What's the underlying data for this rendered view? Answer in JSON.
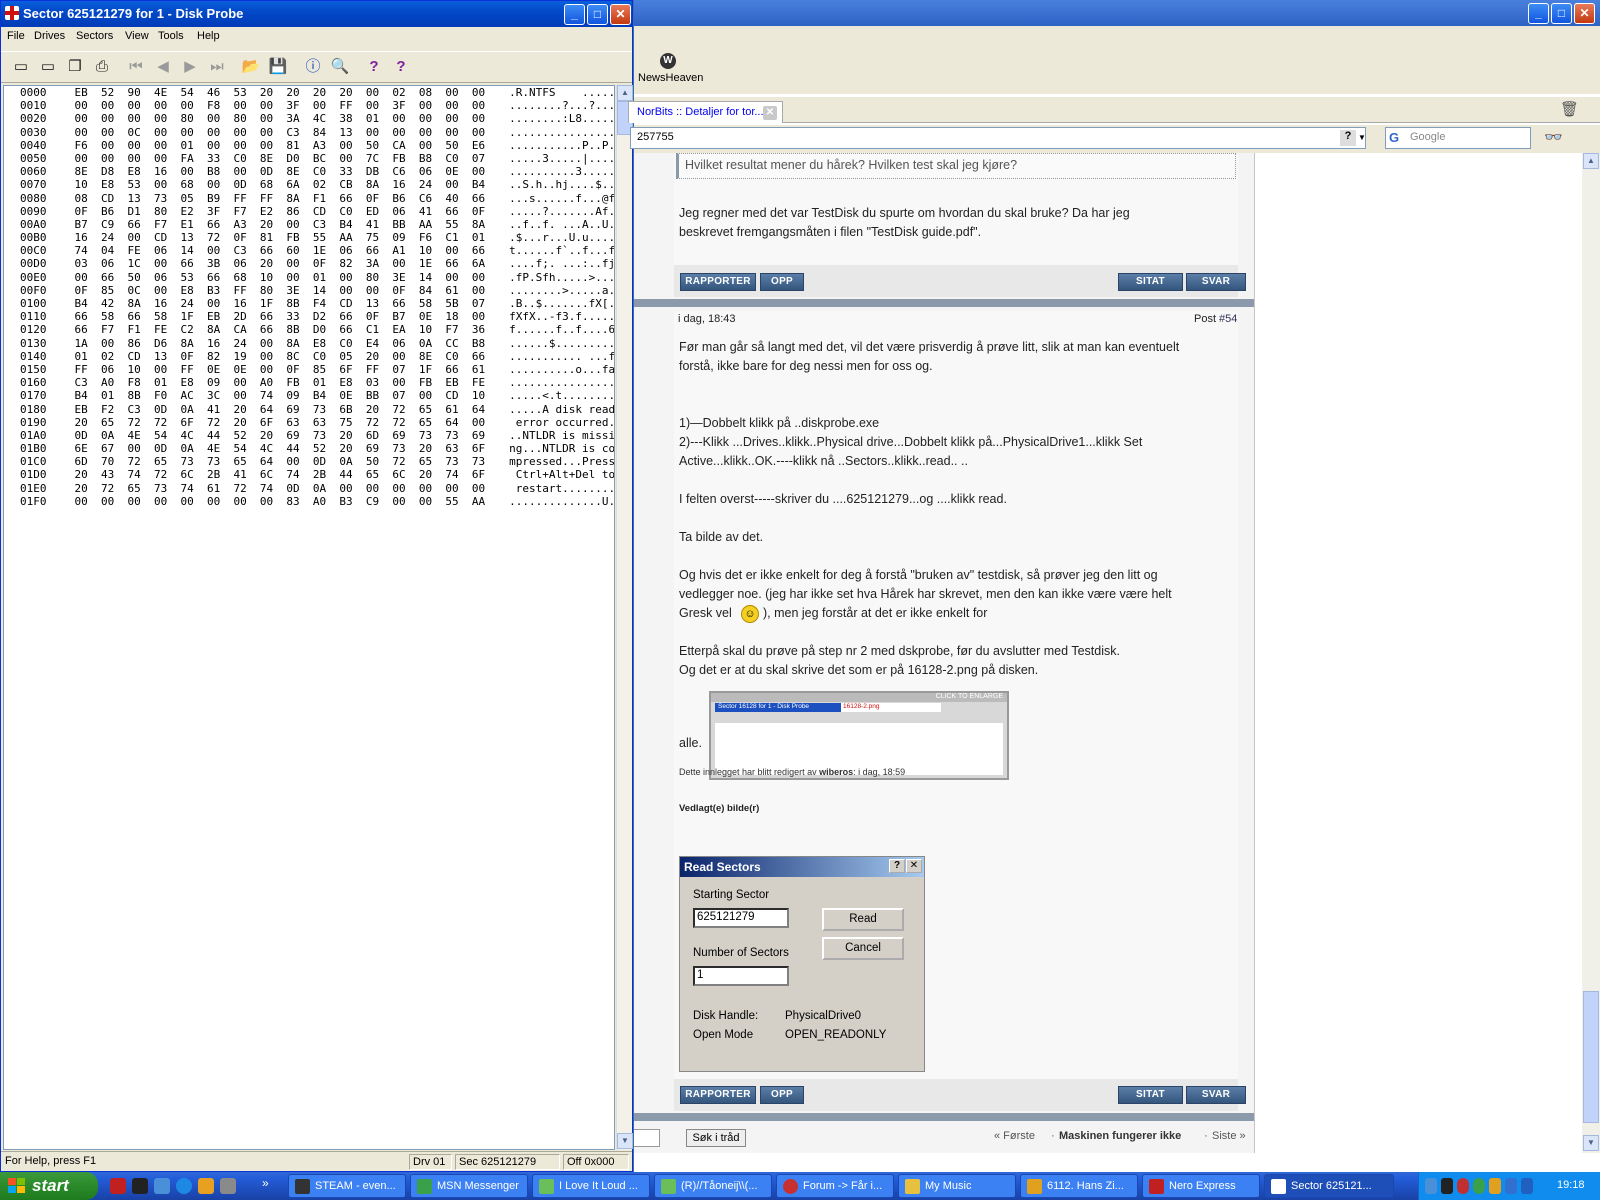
{
  "diskprobe": {
    "title": "Sector 625121279 for 1 - Disk Probe",
    "menu": [
      "File",
      "Drives",
      "Sectors",
      "View",
      "Tools",
      "Help"
    ],
    "hex_rows": [
      [
        "0000",
        "EB 52 90 4E 54 46 53 20 20 20 20 00 02 08 00 00",
        ".R.NTFS    ....."
      ],
      [
        "0010",
        "00 00 00 00 00 F8 00 00 3F 00 FF 00 3F 00 00 00",
        "........?...?..."
      ],
      [
        "0020",
        "00 00 00 00 80 00 80 00 3A 4C 38 01 00 00 00 00",
        "........:L8....."
      ],
      [
        "0030",
        "00 00 0C 00 00 00 00 00 C3 84 13 00 00 00 00 00",
        "................"
      ],
      [
        "0040",
        "F6 00 00 00 01 00 00 00 81 A3 00 50 CA 00 50 E6",
        "...........P..P."
      ],
      [
        "0050",
        "00 00 00 00 FA 33 C0 8E D0 BC 00 7C FB B8 C0 07",
        ".....3.....|...."
      ],
      [
        "0060",
        "8E D8 E8 16 00 B8 00 0D 8E C0 33 DB C6 06 0E 00",
        "..........3....."
      ],
      [
        "0070",
        "10 E8 53 00 68 00 0D 68 6A 02 CB 8A 16 24 00 B4",
        "..S.h..hj....$.."
      ],
      [
        "0080",
        "08 CD 13 73 05 B9 FF FF 8A F1 66 0F B6 C6 40 66",
        "...s......f...@f"
      ],
      [
        "0090",
        "0F B6 D1 80 E2 3F F7 E2 86 CD C0 ED 06 41 66 0F",
        ".....?.......Af."
      ],
      [
        "00A0",
        "B7 C9 66 F7 E1 66 A3 20 00 C3 B4 41 BB AA 55 8A",
        "..f..f. ...A..U."
      ],
      [
        "00B0",
        "16 24 00 CD 13 72 0F 81 FB 55 AA 75 09 F6 C1 01",
        ".$...r...U.u...."
      ],
      [
        "00C0",
        "74 04 FE 06 14 00 C3 66 60 1E 06 66 A1 10 00 66",
        "t......f`..f...f"
      ],
      [
        "00D0",
        "03 06 1C 00 66 3B 06 20 00 0F 82 3A 00 1E 66 6A",
        "....f;. ...:..fj"
      ],
      [
        "00E0",
        "00 66 50 06 53 66 68 10 00 01 00 80 3E 14 00 00",
        ".fP.Sfh.....>..."
      ],
      [
        "00F0",
        "0F 85 0C 00 E8 B3 FF 80 3E 14 00 00 0F 84 61 00",
        "........>.....a."
      ],
      [
        "0100",
        "B4 42 8A 16 24 00 16 1F 8B F4 CD 13 66 58 5B 07",
        ".B..$.......fX[."
      ],
      [
        "0110",
        "66 58 66 58 1F EB 2D 66 33 D2 66 0F B7 0E 18 00",
        "fXfX..-f3.f....."
      ],
      [
        "0120",
        "66 F7 F1 FE C2 8A CA 66 8B D0 66 C1 EA 10 F7 36",
        "f......f..f....6"
      ],
      [
        "0130",
        "1A 00 86 D6 8A 16 24 00 8A E8 C0 E4 06 0A CC B8",
        "......$........."
      ],
      [
        "0140",
        "01 02 CD 13 0F 82 19 00 8C C0 05 20 00 8E C0 66",
        "........... ...f"
      ],
      [
        "0150",
        "FF 06 10 00 FF 0E 0E 00 0F 85 6F FF 07 1F 66 61",
        "..........o...fa"
      ],
      [
        "0160",
        "C3 A0 F8 01 E8 09 00 A0 FB 01 E8 03 00 FB EB FE",
        "................"
      ],
      [
        "0170",
        "B4 01 8B F0 AC 3C 00 74 09 B4 0E BB 07 00 CD 10",
        ".....<.t........"
      ],
      [
        "0180",
        "EB F2 C3 0D 0A 41 20 64 69 73 6B 20 72 65 61 64",
        ".....A disk read"
      ],
      [
        "0190",
        "20 65 72 72 6F 72 20 6F 63 63 75 72 72 65 64 00",
        " error occurred."
      ],
      [
        "01A0",
        "0D 0A 4E 54 4C 44 52 20 69 73 20 6D 69 73 73 69",
        "..NTLDR is missi"
      ],
      [
        "01B0",
        "6E 67 00 0D 0A 4E 54 4C 44 52 20 69 73 20 63 6F",
        "ng...NTLDR is co"
      ],
      [
        "01C0",
        "6D 70 72 65 73 73 65 64 00 0D 0A 50 72 65 73 73",
        "mpressed...Press"
      ],
      [
        "01D0",
        "20 43 74 72 6C 2B 41 6C 74 2B 44 65 6C 20 74 6F",
        " Ctrl+Alt+Del to"
      ],
      [
        "01E0",
        "20 72 65 73 74 61 72 74 0D 0A 00 00 00 00 00 00",
        " restart........"
      ],
      [
        "01F0",
        "00 00 00 00 00 00 00 00 83 A0 B3 C9 00 00 55 AA",
        "..............U."
      ]
    ],
    "status": {
      "help": "For Help, press F1",
      "drv": "Drv  01",
      "sec": "Sec 625121279",
      "off": "Off 0x000"
    }
  },
  "browser": {
    "bookmark": "NewsHeaven",
    "tab_title": "NorBits :: Detaljer for tor...",
    "url_fragment": "257755",
    "search_placeholder": "Google",
    "quote": "Hvilket resultat mener du hårek? Hvilken test skal jeg kjøre?",
    "reply_line1": "Jeg regner med det var TestDisk du spurte om hvordan du skal bruke? Da har jeg",
    "reply_line2": "beskrevet fremgangsmåten i filen \"TestDisk guide.pdf\".",
    "btn_report": "RAPPORTER",
    "btn_up": "OPP",
    "btn_quote": "SITAT",
    "btn_reply": "SVAR",
    "post_date": "i dag, 18:43",
    "post_label": "Post",
    "post_number": "#54",
    "lines": [
      "Før man går så langt med det, vil det være prisverdig å prøve litt, slik at man kan eventuelt",
      "forstå, ikke bare for deg nessi men for oss og.",
      "1)—Dobbelt klikk på ..diskprobe.exe",
      "2)---Klikk ...Drives..klikk..Physical drive...Dobbelt klikk på...PhysicalDrive1...klikk Set",
      "Active...klikk..OK.----klikk nå ..Sectors..klikk..read.. ..",
      "I felten overst-----skriver du ....625121279...og ....klikk read.",
      "Ta bilde av det.",
      "Og hvis det er ikke enkelt for deg å forstå \"bruken av\" testdisk, så prøver jeg den litt og",
      "vedlegger noe. (jeg har ikke set hva Hårek har skrevet, men den kan ikke være være helt",
      "Gresk vel",
      "), men jeg forstår at det er ikke enkelt for",
      "Etterpå skal du prøve på step nr 2 med dskprobe, før du avslutter med Testdisk.",
      "Og det er at du skal skrive det som er på 16128-2.png på disken.",
      "alle."
    ],
    "thumb_caption": "CLICK TO ENLARGE",
    "thumb_title": "Sector 16128 for 1 - Disk Probe",
    "thumb_file": "16128-2.png",
    "edited_prefix": "Dette innlegget har blitt redigert av",
    "edited_user": "wiberos",
    "edited_when": ": i dag, 18:59",
    "attached": "Vedlagt(e) bilde(r)",
    "dialog": {
      "title": "Read Sectors",
      "starting_label": "Starting Sector",
      "starting_value": "625121279",
      "number_label": "Number of Sectors",
      "number_value": "1",
      "read": "Read",
      "cancel": "Cancel",
      "handle_label": "Disk Handle:",
      "handle_value": "PhysicalDrive0",
      "mode_label": "Open Mode",
      "mode_value": "OPEN_READONLY"
    },
    "search_thread": "Søk i tråd",
    "pager": {
      "first": "« Første",
      "title": "Maskinen fungerer ikke",
      "last": "Siste »"
    }
  },
  "taskbar": {
    "start": "start",
    "items": [
      "STEAM - even...",
      "MSN Messenger",
      "I Love It Loud ...",
      "(R)//Tåoneij\\\\(...",
      "Forum -> Får i...",
      "My Music",
      "6112. Hans Zi...",
      "Nero Express",
      "Sector 625121..."
    ],
    "clock": "19:18"
  }
}
